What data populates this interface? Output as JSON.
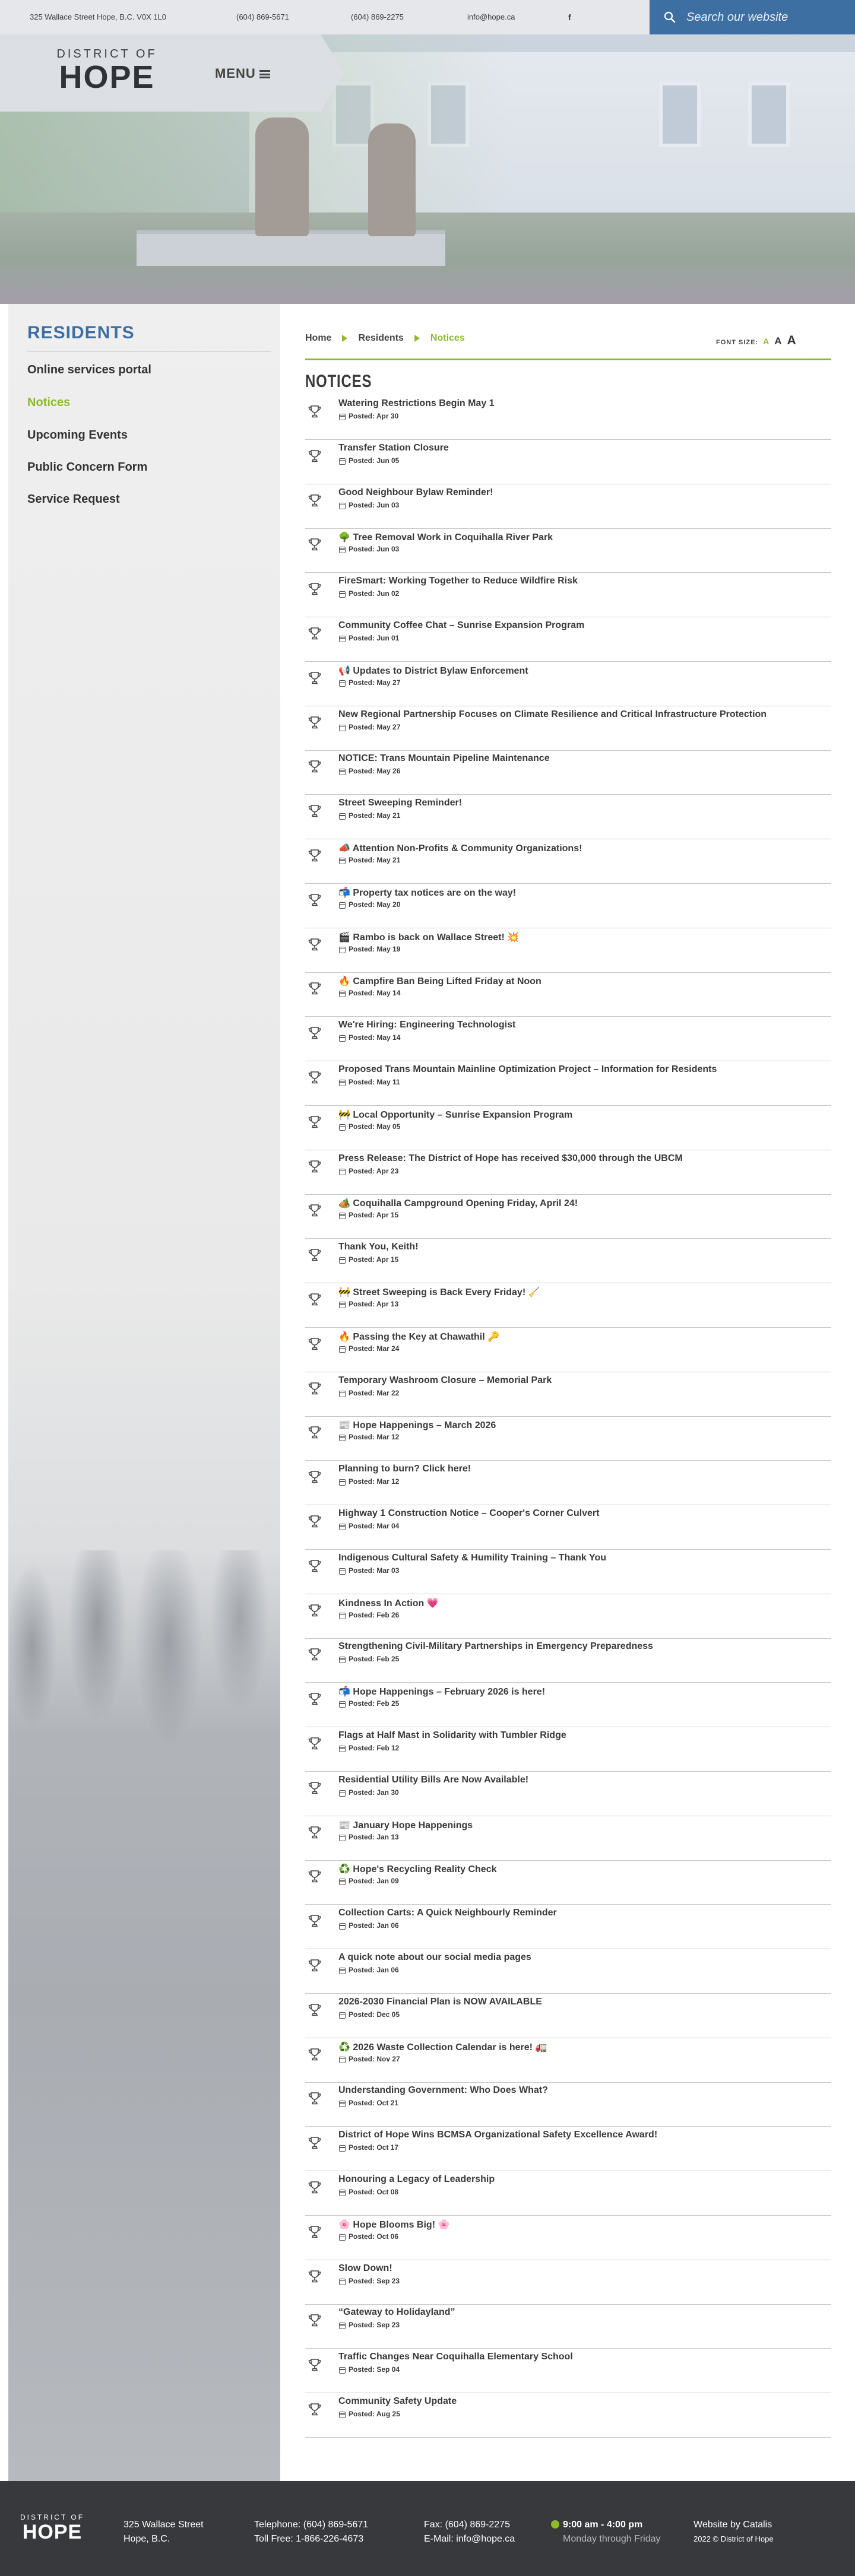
{
  "topbar": {
    "address": "325 Wallace Street Hope, B.C. V0X 1L0",
    "phone": "(604) 869-5671",
    "fax": "(604) 869-2275",
    "email": "info@hope.ca",
    "facebook": "f",
    "search_placeholder": "Search our website"
  },
  "brand": {
    "line1": "DISTRICT OF",
    "line2": "HOPE"
  },
  "menu": {
    "label": "MENU"
  },
  "sidebar": {
    "title": "RESIDENTS",
    "items": [
      {
        "label": "Online services portal"
      },
      {
        "label": "Notices"
      },
      {
        "label": "Upcoming Events"
      },
      {
        "label": "Public Concern Form"
      },
      {
        "label": "Service Request"
      }
    ]
  },
  "breadcrumb": {
    "home": "Home",
    "section": "Residents",
    "current": "Notices"
  },
  "font_size": {
    "label": "FONT SIZE:",
    "small": "A",
    "medium": "A",
    "large": "A"
  },
  "page_title": "NOTICES",
  "notices": [
    {
      "title": "Watering Restrictions Begin May 1",
      "date": "Posted: Apr 30"
    },
    {
      "title": "Transfer Station Closure",
      "date": "Posted: Jun 05"
    },
    {
      "title": "Good Neighbour Bylaw Reminder!",
      "date": "Posted: Jun 03"
    },
    {
      "title": "🌳 Tree Removal Work in Coquihalla River Park",
      "date": "Posted: Jun 03"
    },
    {
      "title": "FireSmart: Working Together to Reduce Wildfire Risk",
      "date": "Posted: Jun 02"
    },
    {
      "title": "Community Coffee Chat – Sunrise Expansion Program",
      "date": "Posted: Jun 01"
    },
    {
      "title": "📢 Updates to District Bylaw Enforcement",
      "date": "Posted: May 27"
    },
    {
      "title": "New Regional Partnership Focuses on Climate Resilience and Critical Infrastructure Protection",
      "date": "Posted: May 27"
    },
    {
      "title": "NOTICE: Trans Mountain Pipeline Maintenance",
      "date": "Posted: May 26"
    },
    {
      "title": "Street Sweeping Reminder!",
      "date": "Posted: May 21"
    },
    {
      "title": "📣 Attention Non-Profits & Community Organizations!",
      "date": "Posted: May 21"
    },
    {
      "title": "📬 Property tax notices are on the way!",
      "date": "Posted: May 20"
    },
    {
      "title": "🎬 Rambo is back on Wallace Street! 💥",
      "date": "Posted: May 19"
    },
    {
      "title": "🔥 Campfire Ban Being Lifted Friday at Noon",
      "date": "Posted: May 14"
    },
    {
      "title": "We're Hiring: Engineering Technologist",
      "date": "Posted: May 14"
    },
    {
      "title": "Proposed Trans Mountain Mainline Optimization Project – Information for Residents",
      "date": "Posted: May 11"
    },
    {
      "title": "🚧 Local Opportunity – Sunrise Expansion Program",
      "date": "Posted: May 05"
    },
    {
      "title": "Press Release: The District of Hope has received $30,000 through the UBCM",
      "date": "Posted: Apr 23"
    },
    {
      "title": "🏕️ Coquihalla Campground Opening Friday, April 24!",
      "date": "Posted: Apr 15"
    },
    {
      "title": "Thank You, Keith!",
      "date": "Posted: Apr 15"
    },
    {
      "title": "🚧 Street Sweeping is Back Every Friday! 🧹",
      "date": "Posted: Apr 13"
    },
    {
      "title": "🔥 Passing the Key at Chawathil 🔑",
      "date": "Posted: Mar 24"
    },
    {
      "title": "Temporary Washroom Closure – Memorial Park",
      "date": "Posted: Mar 22"
    },
    {
      "title": "📰 Hope Happenings – March 2026",
      "date": "Posted: Mar 12"
    },
    {
      "title": "Planning to burn? Click here!",
      "date": "Posted: Mar 12"
    },
    {
      "title": "Highway 1 Construction Notice – Cooper's Corner Culvert",
      "date": "Posted: Mar 04"
    },
    {
      "title": "Indigenous Cultural Safety & Humility Training – Thank You",
      "date": "Posted: Mar 03"
    },
    {
      "title": "Kindness In Action 💗",
      "date": "Posted: Feb 26"
    },
    {
      "title": "Strengthening Civil-Military Partnerships in Emergency Preparedness",
      "date": "Posted: Feb 25"
    },
    {
      "title": "📬 Hope Happenings – February 2026 is here!",
      "date": "Posted: Feb 25"
    },
    {
      "title": "Flags at Half Mast in Solidarity with Tumbler Ridge",
      "date": "Posted: Feb 12"
    },
    {
      "title": "Residential Utility Bills Are Now Available!",
      "date": "Posted: Jan 30"
    },
    {
      "title": "📰 January Hope Happenings",
      "date": "Posted: Jan 13"
    },
    {
      "title": "♻️ Hope's Recycling Reality Check",
      "date": "Posted: Jan 09"
    },
    {
      "title": "Collection Carts: A Quick Neighbourly Reminder",
      "date": "Posted: Jan 06"
    },
    {
      "title": "A quick note about our social media pages",
      "date": "Posted: Jan 06"
    },
    {
      "title": "2026-2030 Financial Plan is NOW AVAILABLE",
      "date": "Posted: Dec 05"
    },
    {
      "title": "♻️ 2026 Waste Collection Calendar is here! 🚛",
      "date": "Posted: Nov 27"
    },
    {
      "title": "Understanding Government: Who Does What?",
      "date": "Posted: Oct 21"
    },
    {
      "title": "District of Hope Wins BCMSA Organizational Safety Excellence Award!",
      "date": "Posted: Oct 17"
    },
    {
      "title": "Honouring a Legacy of Leadership",
      "date": "Posted: Oct 08"
    },
    {
      "title": "🌸 Hope Blooms Big! 🌸",
      "date": "Posted: Oct 06"
    },
    {
      "title": "Slow Down!",
      "date": "Posted: Sep 23"
    },
    {
      "title": "“Gateway to Holidayland”",
      "date": "Posted: Sep 23"
    },
    {
      "title": "Traffic Changes Near Coquihalla Elementary School",
      "date": "Posted: Sep 04"
    },
    {
      "title": "Community Safety Update",
      "date": "Posted: Aug 25"
    }
  ],
  "footer": {
    "logo_line1": "DISTRICT OF",
    "logo_line2": "HOPE",
    "address1": "325 Wallace Street",
    "address2": "Hope, B.C.",
    "telephone": "Telephone: (604) 869-5671",
    "tollfree": "Toll Free: 1-866-226-4673",
    "fax": "Fax: (604) 869-2275",
    "email": "E-Mail: info@hope.ca",
    "hours": "9:00 am - 4:00 pm",
    "days": "Monday through Friday",
    "credit": "Website by Catalis",
    "copyright": "2022 © District of Hope"
  },
  "colors": {
    "accent_green": "#8dbb2c",
    "brand_blue": "#3e6fa3",
    "footer_bg": "#38393c"
  }
}
